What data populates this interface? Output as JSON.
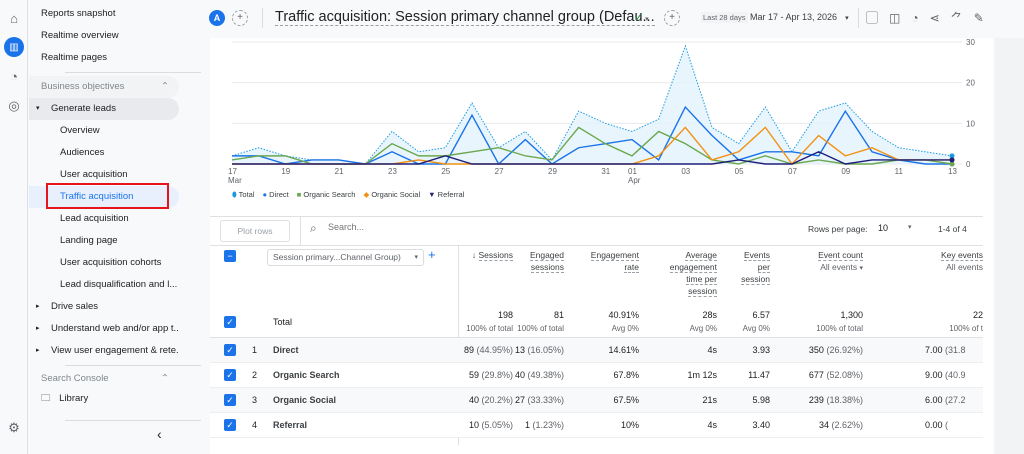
{
  "rail": {
    "icons": [
      "home-icon",
      "reports-icon",
      "explore-icon",
      "advertising-icon",
      "settings-icon"
    ]
  },
  "sidebar": {
    "top_items": [
      "Reports snapshot",
      "Realtime overview",
      "Realtime pages"
    ],
    "section1": "Business objectives",
    "group": "Generate leads",
    "sub_items": [
      "Overview",
      "Audiences",
      "User acquisition",
      "Traffic acquisition",
      "Lead acquisition",
      "Landing page",
      "User acquisition cohorts",
      "Lead disqualification and l..."
    ],
    "selected": "Traffic acquisition",
    "collapsed_groups": [
      "Drive sales",
      "Understand web and/or app t...",
      "View user engagement & rete..."
    ],
    "section2": "Search Console",
    "library": "Library",
    "collapse_icon": "chevron-left-icon"
  },
  "header": {
    "avatar": "A",
    "title": "Traffic acquisition: Session primary channel group (Defau...",
    "date_label": "Last 28 days",
    "date_range": "Mar 17 - Apr 13, 2026"
  },
  "colors": {
    "total": "#1a9be0",
    "direct": "#1a73e8",
    "organic_search": "#6aa84f",
    "organic_social": "#f29111",
    "referral": "#1f1f7a",
    "accent": "#1a73e8",
    "highlight": "#e8141c"
  },
  "chart_data": {
    "type": "line",
    "x": [
      "Mar 17",
      "Mar 18",
      "Mar 19",
      "Mar 20",
      "Mar 21",
      "Mar 22",
      "Mar 23",
      "Mar 24",
      "Mar 25",
      "Mar 26",
      "Mar 27",
      "Mar 28",
      "Mar 29",
      "Mar 30",
      "Mar 31",
      "Apr 01",
      "Apr 02",
      "Apr 03",
      "Apr 04",
      "Apr 05",
      "Apr 06",
      "Apr 07",
      "Apr 08",
      "Apr 09",
      "Apr 10",
      "Apr 11",
      "Apr 12",
      "Apr 13"
    ],
    "xticks": [
      {
        "label": "17",
        "sub": "Mar",
        "i": 0
      },
      {
        "label": "19",
        "i": 2
      },
      {
        "label": "21",
        "i": 4
      },
      {
        "label": "23",
        "i": 6
      },
      {
        "label": "25",
        "i": 8
      },
      {
        "label": "27",
        "i": 10
      },
      {
        "label": "29",
        "i": 12
      },
      {
        "label": "31",
        "i": 14
      },
      {
        "label": "01",
        "sub": "Apr",
        "i": 15
      },
      {
        "label": "03",
        "i": 17
      },
      {
        "label": "05",
        "i": 19
      },
      {
        "label": "07",
        "i": 21
      },
      {
        "label": "09",
        "i": 23
      },
      {
        "label": "11",
        "i": 25
      },
      {
        "label": "13",
        "i": 27
      }
    ],
    "yticks": [
      0,
      10,
      20,
      30
    ],
    "ylim": [
      0,
      30
    ],
    "grid": true,
    "legend_position": "bottom-left",
    "series": [
      {
        "name": "Total",
        "key": "total",
        "values": [
          2,
          4,
          2,
          1,
          1,
          0,
          8,
          3,
          4,
          15,
          4,
          8,
          1,
          13,
          10,
          8,
          11,
          29,
          9,
          5,
          14,
          3,
          13,
          15,
          8,
          4,
          3,
          2
        ]
      },
      {
        "name": "Direct",
        "key": "direct",
        "values": [
          2,
          2,
          0,
          1,
          1,
          0,
          3,
          0,
          0,
          12,
          0,
          6,
          0,
          4,
          5,
          6,
          1,
          14,
          7,
          1,
          3,
          3,
          2,
          13,
          3,
          1,
          0,
          0
        ]
      },
      {
        "name": "Organic Search",
        "key": "organic_search",
        "values": [
          1,
          2,
          2,
          0,
          0,
          0,
          5,
          2,
          2,
          3,
          4,
          2,
          1,
          9,
          5,
          2,
          8,
          5,
          1,
          0,
          2,
          0,
          1,
          0,
          0,
          1,
          1,
          0
        ]
      },
      {
        "name": "Organic Social",
        "key": "organic_social",
        "values": [
          0,
          0,
          0,
          0,
          0,
          0,
          0,
          1,
          0,
          0,
          0,
          0,
          0,
          0,
          0,
          0,
          2,
          9,
          1,
          3,
          9,
          0,
          7,
          2,
          4,
          1,
          1,
          1
        ]
      },
      {
        "name": "Referral",
        "key": "referral",
        "values": [
          0,
          0,
          0,
          0,
          0,
          0,
          0,
          0,
          2,
          0,
          0,
          0,
          0,
          0,
          0,
          0,
          0,
          0,
          0,
          1,
          0,
          0,
          3,
          0,
          1,
          1,
          1,
          1
        ]
      }
    ]
  },
  "toolbar": {
    "plot_rows": "Plot rows",
    "search_placeholder": "Search...",
    "rows_per_page_label": "Rows per page:",
    "rows_per_page": "10",
    "pagination": "1-4 of 4"
  },
  "table": {
    "dimension": "Session primary...Channel Group)",
    "columns": [
      {
        "label": "Sessions",
        "sorted": true
      },
      {
        "label": "Engaged sessions"
      },
      {
        "label": "Engagement rate"
      },
      {
        "label": "Average engagement time per session"
      },
      {
        "label": "Events per session"
      },
      {
        "label": "Event count",
        "filter": "All events"
      },
      {
        "label": "Key events",
        "filter": "All events"
      }
    ],
    "total": {
      "label": "Total",
      "values": [
        "198",
        "81",
        "40.91%",
        "28s",
        "6.57",
        "1,300",
        "22"
      ],
      "subs": [
        "100% of total",
        "100% of total",
        "Avg 0%",
        "Avg 0%",
        "Avg 0%",
        "100% of total",
        "100% of t"
      ]
    },
    "rows": [
      {
        "n": "1",
        "name": "Direct",
        "values": [
          "89",
          "13",
          "14.61%",
          "4s",
          "3.93",
          "350",
          "7.00"
        ],
        "pcts": [
          "(44.95%)",
          "(16.05%)",
          "",
          "",
          "",
          "(26.92%)",
          "(31.8"
        ]
      },
      {
        "n": "2",
        "name": "Organic Search",
        "values": [
          "59",
          "40",
          "67.8%",
          "1m 12s",
          "11.47",
          "677",
          "9.00"
        ],
        "pcts": [
          "(29.8%)",
          "(49.38%)",
          "",
          "",
          "",
          "(52.08%)",
          "(40.9"
        ]
      },
      {
        "n": "3",
        "name": "Organic Social",
        "values": [
          "40",
          "27",
          "67.5%",
          "21s",
          "5.98",
          "239",
          "6.00"
        ],
        "pcts": [
          "(20.2%)",
          "(33.33%)",
          "",
          "",
          "",
          "(18.38%)",
          "(27.2"
        ]
      },
      {
        "n": "4",
        "name": "Referral",
        "values": [
          "10",
          "1",
          "10%",
          "4s",
          "3.40",
          "34",
          "0.00"
        ],
        "pcts": [
          "(5.05%)",
          "(1.23%)",
          "",
          "",
          "",
          "(2.62%)",
          "("
        ]
      }
    ]
  }
}
